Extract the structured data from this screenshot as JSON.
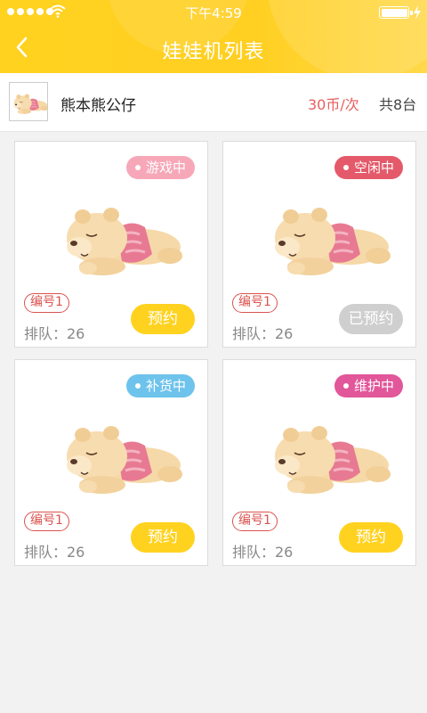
{
  "status_bar": {
    "time": "下午4:59"
  },
  "header": {
    "title": "娃娃机列表"
  },
  "info": {
    "name": "熊本熊公仔",
    "price": "30币/次",
    "total": "共8台"
  },
  "machines": [
    {
      "status": "游戏中",
      "status_color": "#f7a8b8",
      "number": "编号1",
      "queue": "排队：26",
      "button": "预约",
      "reserved": false
    },
    {
      "status": "空闲中",
      "status_color": "#e45a6a",
      "number": "编号1",
      "queue": "排队：26",
      "button": "已预约",
      "reserved": true
    },
    {
      "status": "补货中",
      "status_color": "#6ec3ec",
      "number": "编号1",
      "queue": "排队：26",
      "button": "预约",
      "reserved": false
    },
    {
      "status": "维护中",
      "status_color": "#e2569a",
      "number": "编号1",
      "queue": "排队：26",
      "button": "预约",
      "reserved": false
    }
  ],
  "colors": {
    "accent": "#ffd21f",
    "price": "#e95d5d",
    "reserved_button": "#cfcfcf",
    "number_badge": "#d9534f"
  }
}
